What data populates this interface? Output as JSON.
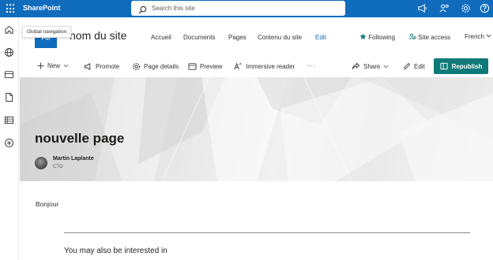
{
  "suitebar": {
    "brand": "SharePoint",
    "search_placeholder": "Search this site",
    "background": "#0f6cbd"
  },
  "rail": {
    "tooltip": "Global navigation",
    "icons": [
      "home-icon",
      "globe-icon",
      "news-icon",
      "document-icon",
      "list-icon",
      "add-circle-icon"
    ]
  },
  "site": {
    "logo_text": "FM",
    "title": "nom du site",
    "nav": [
      "Accueil",
      "Documents",
      "Pages",
      "Contenu du site"
    ],
    "edit_label": "Edit",
    "follow_label": "Following",
    "site_access_label": "Site access",
    "language": "French"
  },
  "commandbar": {
    "new": "New",
    "promote": "Promote",
    "page_details": "Page details",
    "preview": "Preview",
    "immersive_reader": "Immersive reader",
    "more": "···",
    "share": "Share",
    "edit": "Edit",
    "republish": "Republish",
    "republish_color": "#0e7a78"
  },
  "page": {
    "title": "nouvelle page",
    "author_name": "Martin Laplante",
    "author_role": "CTO",
    "body_text": "Bonjour",
    "related_heading": "You may also be interested in"
  }
}
